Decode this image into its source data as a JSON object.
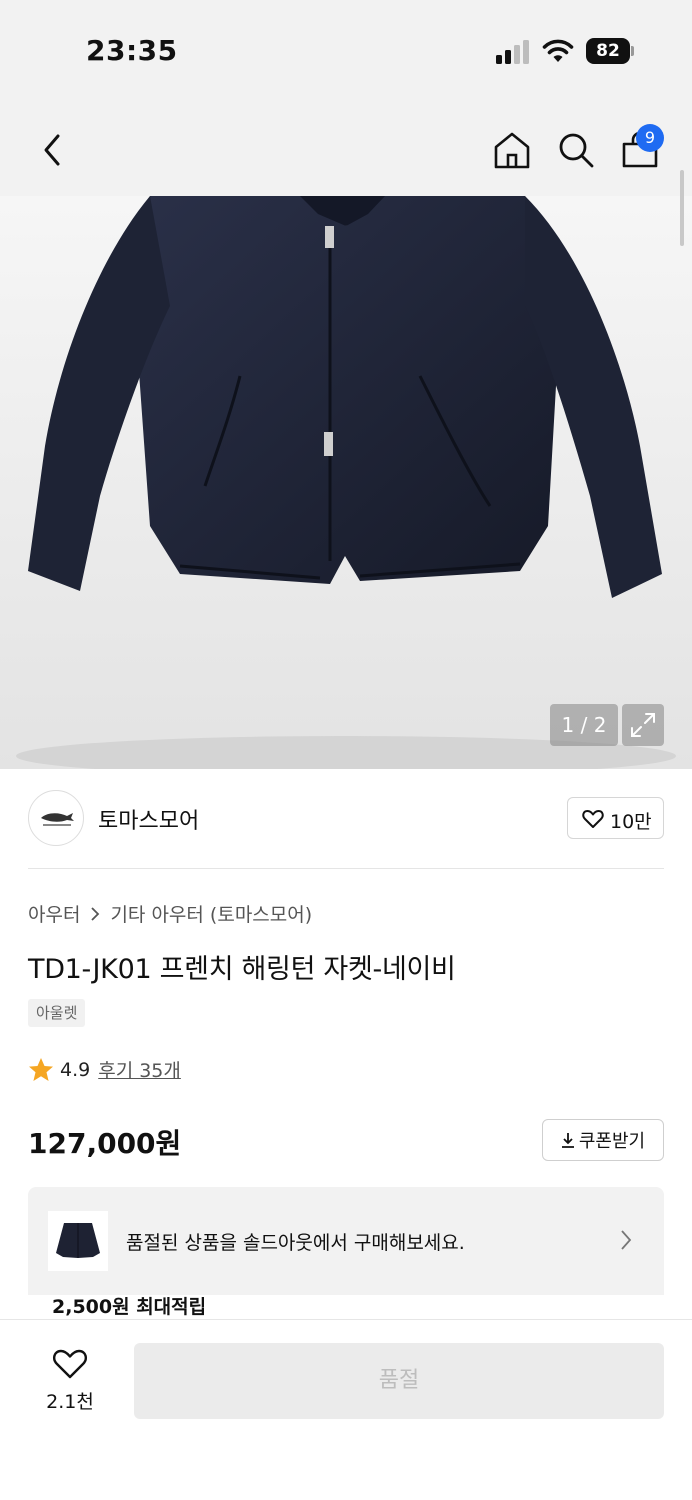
{
  "status_bar": {
    "time": "23:35",
    "battery": "82"
  },
  "nav": {
    "cart_count": "9"
  },
  "gallery": {
    "counter": "1 / 2"
  },
  "brand": {
    "name": "토마스모어",
    "like_count": "10만"
  },
  "product": {
    "breadcrumb": [
      "아우터",
      "기타 아우터 (토마스모어)"
    ],
    "title": "TD1-JK01 프렌치 해링턴 자켓-네이비",
    "tag": "아울렛",
    "rating": "4.9",
    "reviews": "후기 35개",
    "price": "127,000원",
    "coupon_label": "쿠폰받기"
  },
  "banner": {
    "text": "품절된 상품을 솔드아웃에서 구매해보세요.",
    "points": "2,500원 최대적립"
  },
  "bottom": {
    "wish_count": "2.1천",
    "buy_label": "품절"
  },
  "colors": {
    "accent": "#1f6bf2",
    "star": "#f5a623",
    "jacket": "#1e2233"
  }
}
